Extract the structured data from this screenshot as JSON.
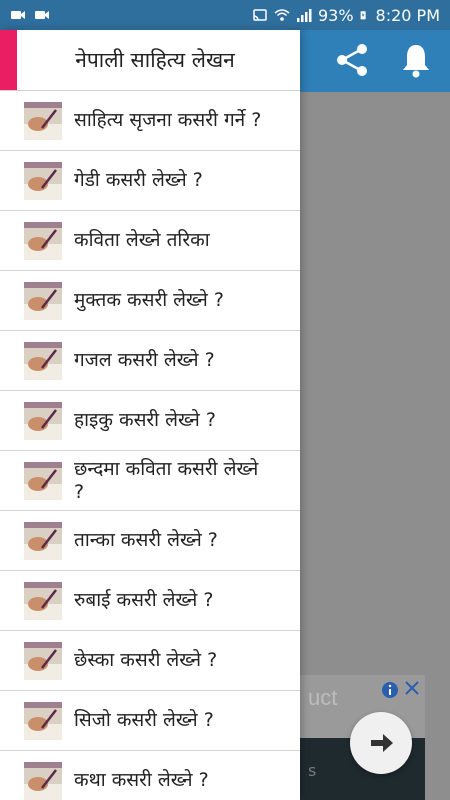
{
  "status_bar": {
    "battery": "93%",
    "time": "8:20 PM"
  },
  "drawer": {
    "title": "नेपाली साहित्य लेखन",
    "accent_color": "#e91e63",
    "items": [
      {
        "label": "साहित्य सृजना कसरी गर्ने ?"
      },
      {
        "label": "गेडी कसरी लेख्ने ?"
      },
      {
        "label": "कविता लेख्ने तरिका"
      },
      {
        "label": "मुक्तक कसरी लेख्ने ?"
      },
      {
        "label": "गजल कसरी लेख्ने ?"
      },
      {
        "label": "हाइकु कसरी लेख्ने ?"
      },
      {
        "label": "छन्दमा कविता कसरी लेख्ने ?"
      },
      {
        "label": "तान्का कसरी लेख्ने ?"
      },
      {
        "label": "रुबाई कसरी लेख्ने ?"
      },
      {
        "label": "छेस्का कसरी लेख्ने ?"
      },
      {
        "label": "सिजो कसरी लेख्ने ?"
      },
      {
        "label": "कथा कसरी लेख्ने ?"
      }
    ]
  },
  "ad": {
    "title_fragment": "uct",
    "sub_fragment": "s"
  },
  "colors": {
    "app_bar": "#2f7fb8",
    "status_bar": "#2f6f9e"
  }
}
